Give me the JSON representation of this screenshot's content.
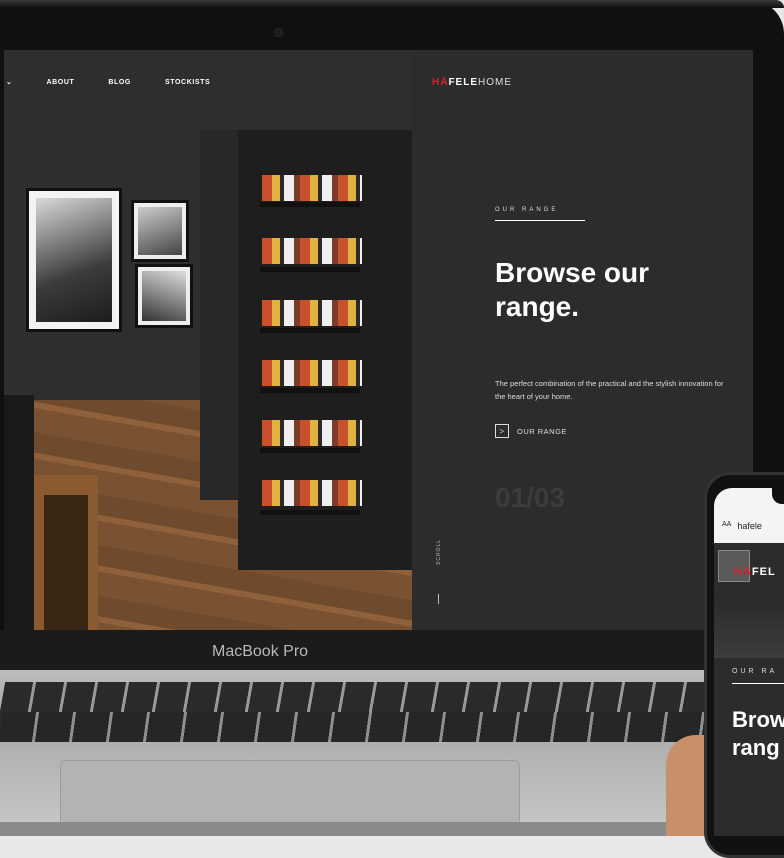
{
  "laptop": {
    "brand": "MacBook Pro"
  },
  "site": {
    "nav": {
      "items": [
        "ABOUT",
        "BLOG",
        "STOCKISTS"
      ]
    },
    "logo": {
      "accent": "HÄ",
      "main": "FELE",
      "suffix": "HOME"
    },
    "hero": {
      "eyebrow": "OUR RANGE",
      "headline": "Browse our range.",
      "body": "The perfect combination of the practical and the stylish innovation for the heart of your home.",
      "cta": "OUR RANGE",
      "counter": "01/03",
      "side_label": "SCROLL"
    }
  },
  "phone": {
    "url_prefix": "AA",
    "url": "hafele",
    "logo_accent": "HÄ",
    "logo_main": "FEL",
    "eyebrow": "OUR RA",
    "headline_line1": "Brow",
    "headline_line2": "rang"
  },
  "colors": {
    "accent": "#d6232a",
    "panel": "#2c2c2c"
  }
}
